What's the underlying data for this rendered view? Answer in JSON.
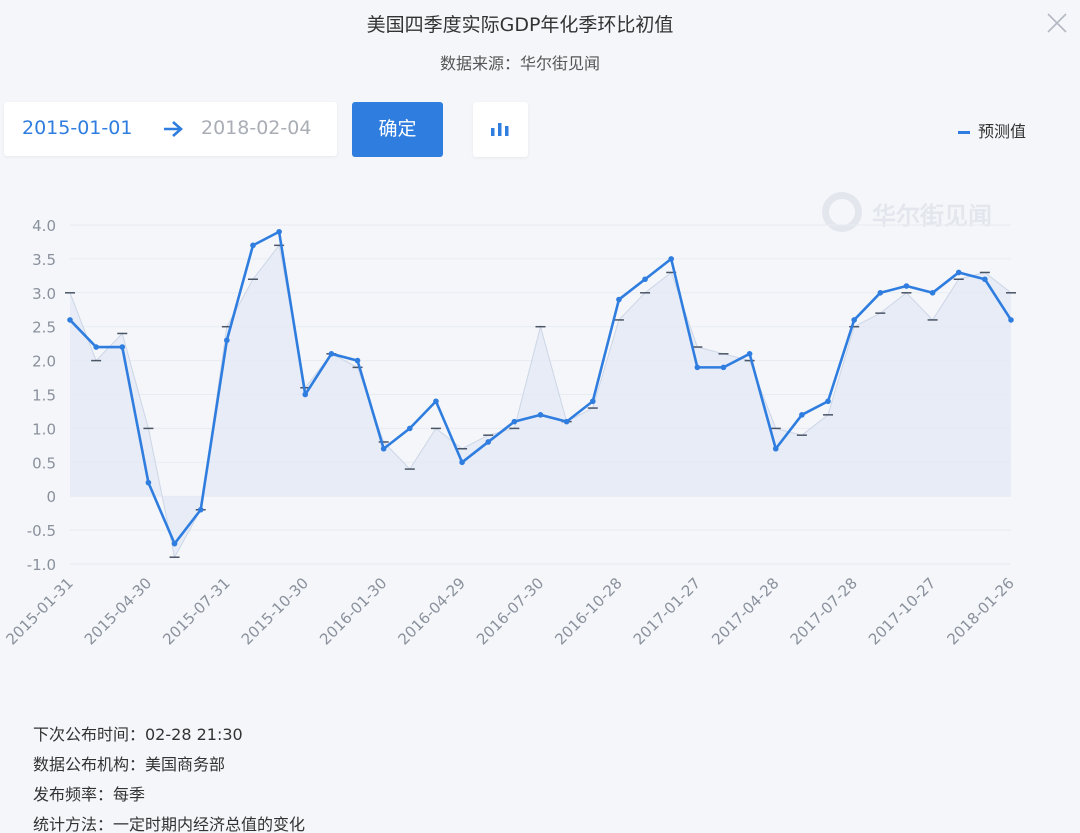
{
  "header": {
    "title": "美国四季度实际GDP年化季环比初值",
    "source": "数据来源：华尔街见闻",
    "close_icon": "close-icon"
  },
  "controls": {
    "start_date": "2015-01-01",
    "end_date": "2018-02-04",
    "arrow_icon": "arrow-right-icon",
    "confirm_label": "确定",
    "chart_toggle_icon": "bar-chart-icon"
  },
  "legend": {
    "forecast_label": "预测值",
    "color": "#2f7ddf"
  },
  "watermark": {
    "text": "华尔街见闻"
  },
  "colors": {
    "actual_line": "#2f7ddf",
    "forecast_area": "#e4eaf6",
    "axis_text": "#8a919c"
  },
  "chart_data": {
    "type": "line",
    "title": "美国四季度实际GDP年化季环比初值",
    "ylim": [
      -1.0,
      4.0
    ],
    "y_ticks": [
      "4.0",
      "3.5",
      "3.0",
      "2.5",
      "2.0",
      "1.5",
      "1.0",
      "0.5",
      "0",
      "-0.5",
      "-1.0"
    ],
    "x_tick_labels": [
      "2015-01-31",
      "2015-04-30",
      "2015-07-31",
      "2015-10-30",
      "2016-01-30",
      "2016-04-29",
      "2016-07-30",
      "2016-10-28",
      "2017-01-27",
      "2017-04-28",
      "2017-07-28",
      "2017-10-27",
      "2018-01-26"
    ],
    "series": [
      {
        "name": "",
        "role": "actual",
        "values": [
          2.6,
          2.2,
          2.2,
          0.2,
          -0.7,
          -0.2,
          2.3,
          3.7,
          3.9,
          1.5,
          2.1,
          2.0,
          0.7,
          1.0,
          1.4,
          0.5,
          0.8,
          1.1,
          1.2,
          1.1,
          1.4,
          2.9,
          3.2,
          3.5,
          1.9,
          1.9,
          2.1,
          0.7,
          1.2,
          1.4,
          2.6,
          3.0,
          3.1,
          3.0,
          3.3,
          3.2,
          2.6
        ]
      },
      {
        "name": "预测值",
        "role": "forecast",
        "values": [
          3.0,
          2.0,
          2.4,
          1.0,
          -0.9,
          -0.2,
          2.5,
          3.2,
          3.7,
          1.6,
          2.1,
          1.9,
          0.8,
          0.4,
          1.0,
          0.7,
          0.9,
          1.0,
          2.5,
          1.1,
          1.3,
          2.6,
          3.0,
          3.3,
          2.2,
          2.1,
          2.0,
          1.0,
          0.9,
          1.2,
          2.5,
          2.7,
          3.0,
          2.6,
          3.2,
          3.3,
          3.0
        ]
      }
    ]
  },
  "info": {
    "next_release": "下次公布时间：02-28 21:30",
    "agency": "数据公布机构：美国商务部",
    "frequency": "发布频率：每季",
    "method": "统计方法：一定时期内经济总值的变化"
  }
}
